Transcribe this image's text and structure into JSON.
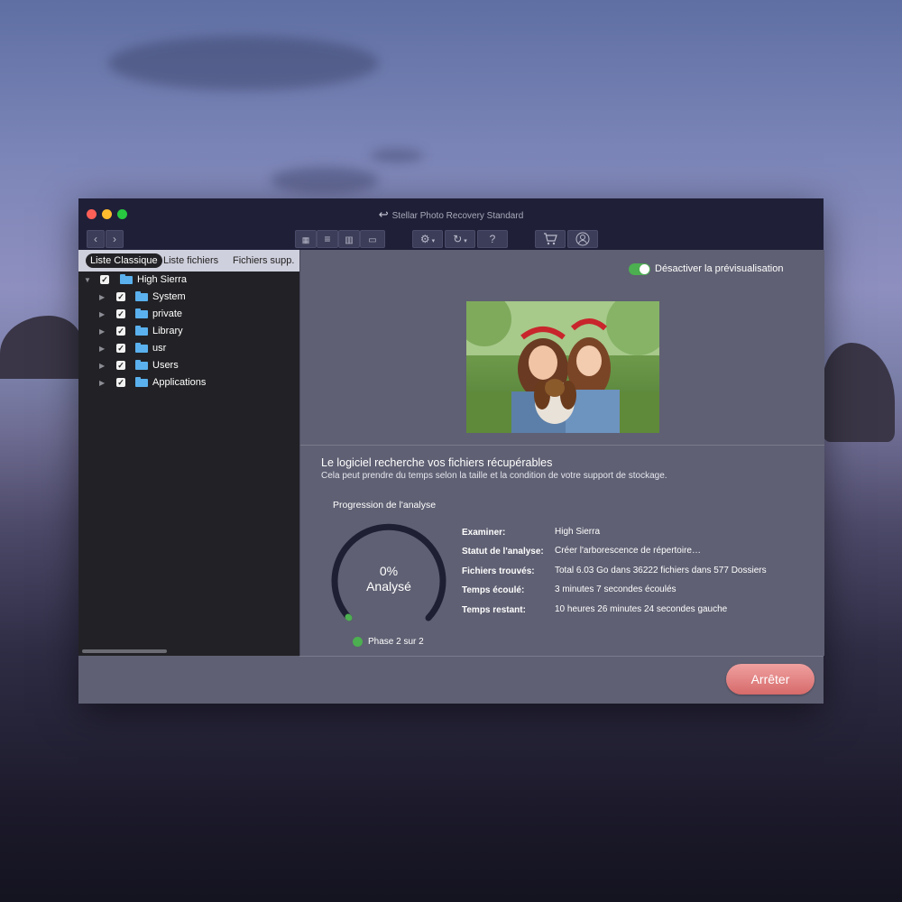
{
  "window": {
    "title": "Stellar Photo Recovery Standard"
  },
  "toolbar": {
    "back": "‹",
    "forward": "›",
    "help": "?"
  },
  "sidebar": {
    "tabs": [
      "Liste Classique",
      "Liste fichiers",
      "Fichiers supp."
    ],
    "root": {
      "label": "High Sierra",
      "checked": true
    },
    "items": [
      {
        "label": "System"
      },
      {
        "label": "private"
      },
      {
        "label": "Library"
      },
      {
        "label": "usr"
      },
      {
        "label": "Users"
      },
      {
        "label": "Applications"
      }
    ]
  },
  "preview": {
    "toggle_label": "Désactiver la prévisualisation",
    "toggle_on": true
  },
  "scan": {
    "heading": "Le logiciel recherche vos fichiers récupérables",
    "subheading": "Cela peut prendre du temps selon la taille et la condition de votre support de stockage.",
    "progress_title": "Progression de l'analyse",
    "percent": "0%",
    "percent_label": "Analysé",
    "progress_fraction": 0,
    "phase": "Phase 2 sur 2",
    "details": [
      {
        "label": "Examiner:",
        "value": "High Sierra"
      },
      {
        "label": "Statut de l'analyse:",
        "value": "Créer l'arborescence de répertoire…"
      },
      {
        "label": "Fichiers trouvés:",
        "value": "Total 6.03 Go dans 36222 fichiers dans 577 Dossiers"
      },
      {
        "label": "Temps écoulé:",
        "value": "3 minutes 7 secondes écoulés"
      },
      {
        "label": "Temps restant:",
        "value": "10 heures 26 minutes 24 secondes gauche"
      }
    ]
  },
  "footer": {
    "stop_label": "Arrêter"
  },
  "colors": {
    "accent_green": "#4caf50",
    "stop_button": "#e07a7a",
    "titlebar": "#1f1f38"
  }
}
